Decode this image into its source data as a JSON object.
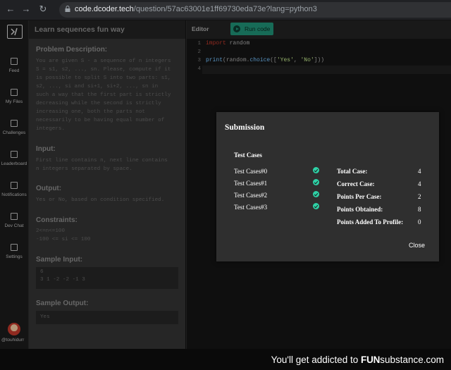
{
  "browser": {
    "url_host": "code.dcoder.tech",
    "url_path": "/question/57ac63001e1ff69730eda73e?lang=python3"
  },
  "sidebar": {
    "items": [
      {
        "label": "Feed",
        "icon": "feed-icon"
      },
      {
        "label": "My Files",
        "icon": "file-icon"
      },
      {
        "label": "Challenges",
        "icon": "challenge-icon"
      },
      {
        "label": "Leaderboard",
        "icon": "leaderboard-icon"
      },
      {
        "label": "Notifications",
        "icon": "bell-icon"
      },
      {
        "label": "Dev Chat",
        "icon": "chat-icon"
      },
      {
        "label": "Settings",
        "icon": "gear-icon"
      }
    ],
    "username": "@touhidurr"
  },
  "problem": {
    "title": "Learn sequences fun way",
    "description_heading": "Problem Description:",
    "description": "You are given S - a sequence of n integers\nS = s1, s2, ..., sn. Please, compute if it\nis possible to split S into two parts: s1,\ns2, ..., si and si+1, si+2, ..., sn in\nsuch a way that the first part is strictly\ndecreasing while the second is strictly\nincreasing one, both the parts not\nnecessarily to be having equal number of\nintegers.",
    "input_heading": "Input:",
    "input": "First line contains n, next line contains\nn integers separated by space.",
    "output_heading": "Output:",
    "output": "Yes or No, based on condition specified.",
    "constraints_heading": "Constraints:",
    "constraints": "2<=n<=100\n-100 <= si <= 100",
    "sample_input_heading": "Sample Input:",
    "sample_input": "6\n3 1 -2 -2 -1 3",
    "sample_output_heading": "Sample Output:",
    "sample_output": "Yes"
  },
  "editor": {
    "title": "Editor",
    "run_label": "Run code",
    "line_numbers": [
      "1",
      "2",
      "3",
      "4"
    ]
  },
  "modal": {
    "title": "Submission",
    "test_heading": "Test Cases",
    "tests": [
      "Test Cases#0",
      "Test Cases#1",
      "Test Cases#2",
      "Test Cases#3"
    ],
    "stats": [
      {
        "label": "Total Case:",
        "value": "4"
      },
      {
        "label": "Correct Case:",
        "value": "4"
      },
      {
        "label": "Points Per Case:",
        "value": "2"
      },
      {
        "label": "Points Obtained:",
        "value": "8"
      },
      {
        "label": "Points Added To Profile:",
        "value": "0"
      }
    ],
    "close_label": "Close"
  },
  "watermark": {
    "text": "You'll get addicted to ",
    "brand1": "FUN",
    "brand2": "substance",
    "brand3": ".com"
  },
  "colors": {
    "accent": "#1f8f74",
    "check": "#2ed1a6",
    "keyword": "#c0392b"
  }
}
